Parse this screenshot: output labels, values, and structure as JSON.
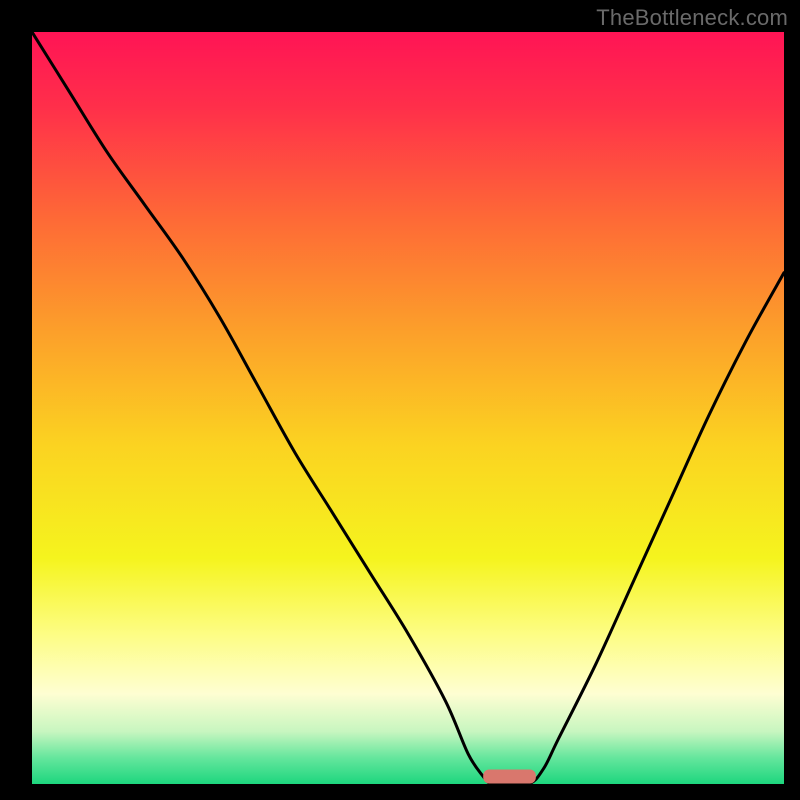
{
  "watermark": "TheBottleneck.com",
  "chart_data": {
    "type": "line",
    "title": "",
    "xlabel": "",
    "ylabel": "",
    "xlim": [
      0,
      100
    ],
    "ylim": [
      0,
      100
    ],
    "series": [
      {
        "name": "bottleneck-curve",
        "x": [
          0,
          5,
          10,
          15,
          20,
          25,
          30,
          35,
          40,
          45,
          50,
          55,
          58,
          60,
          61,
          62,
          66,
          68,
          70,
          75,
          80,
          85,
          90,
          95,
          100
        ],
        "values": [
          100,
          92,
          84,
          77,
          70,
          62,
          53,
          44,
          36,
          28,
          20,
          11,
          4,
          1,
          0,
          0,
          0,
          2,
          6,
          16,
          27,
          38,
          49,
          59,
          68
        ]
      }
    ],
    "markers": [
      {
        "name": "optimal-range",
        "x": [
          60,
          67
        ],
        "y": 1,
        "color": "#d9776d"
      }
    ],
    "gradient_stops": [
      {
        "pos": 0.0,
        "color": "#ff1455"
      },
      {
        "pos": 0.1,
        "color": "#ff2f4a"
      },
      {
        "pos": 0.25,
        "color": "#fe6a36"
      },
      {
        "pos": 0.4,
        "color": "#fca02a"
      },
      {
        "pos": 0.55,
        "color": "#fbd321"
      },
      {
        "pos": 0.7,
        "color": "#f5f41e"
      },
      {
        "pos": 0.8,
        "color": "#fdfd83"
      },
      {
        "pos": 0.88,
        "color": "#fefed2"
      },
      {
        "pos": 0.93,
        "color": "#c8f6c0"
      },
      {
        "pos": 0.965,
        "color": "#65e69d"
      },
      {
        "pos": 1.0,
        "color": "#1dd67e"
      }
    ]
  }
}
